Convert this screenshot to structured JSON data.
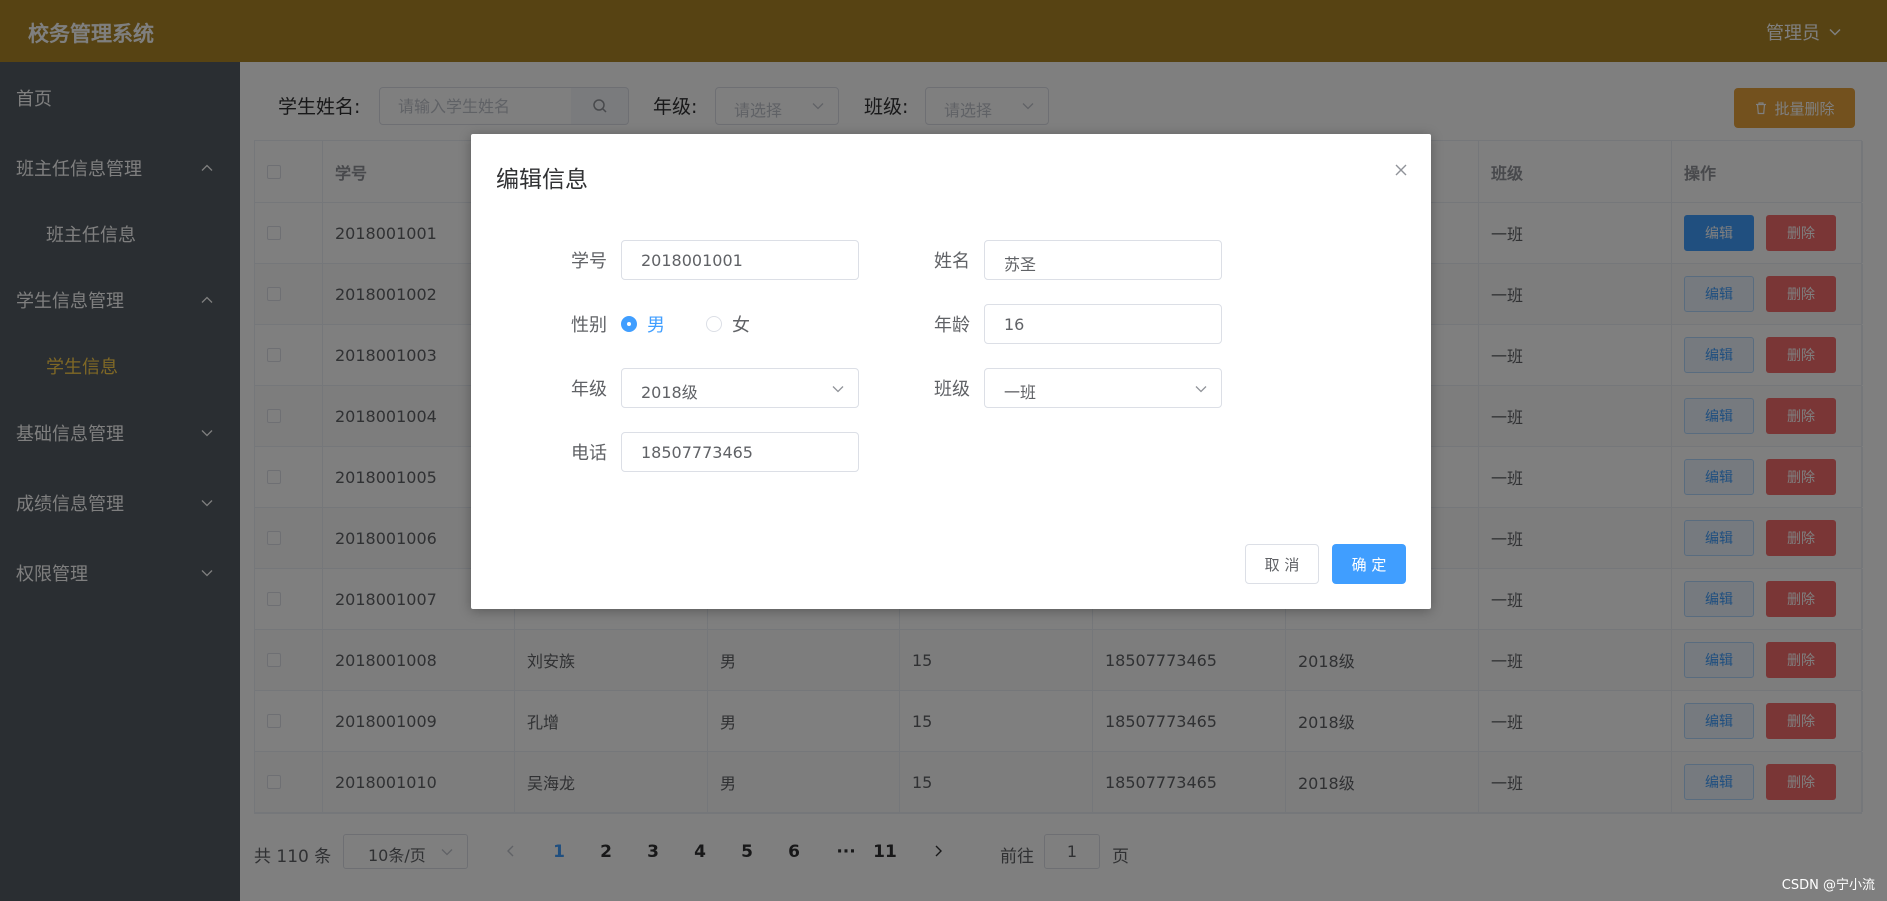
{
  "header": {
    "title": "校务管理系统",
    "user": "管理员"
  },
  "sidebar": {
    "items": [
      {
        "label": "首页"
      },
      {
        "label": "班主任信息管理"
      },
      {
        "label": "班主任信息"
      },
      {
        "label": "学生信息管理"
      },
      {
        "label": "学生信息"
      },
      {
        "label": "基础信息管理"
      },
      {
        "label": "成绩信息管理"
      },
      {
        "label": "权限管理"
      }
    ]
  },
  "filter": {
    "name_label": "学生姓名:",
    "name_placeholder": "请输入学生姓名",
    "grade_label": "年级:",
    "grade_placeholder": "请选择",
    "class_label": "班级:",
    "class_placeholder": "请选择",
    "batch_delete": "批量删除"
  },
  "table": {
    "headers": [
      "学号",
      "班级",
      "操作"
    ],
    "rows": [
      {
        "id": "2018001001",
        "class": "一班"
      },
      {
        "id": "2018001002",
        "class": "一班"
      },
      {
        "id": "2018001003",
        "class": "一班"
      },
      {
        "id": "2018001004",
        "class": "一班"
      },
      {
        "id": "2018001005",
        "class": "一班"
      },
      {
        "id": "2018001006",
        "class": "一班"
      },
      {
        "id": "2018001007",
        "class": "一班"
      },
      {
        "id": "2018001008",
        "name": "刘安族",
        "gender": "男",
        "age": "15",
        "phone": "18507773465",
        "grade": "2018级",
        "class": "一班"
      },
      {
        "id": "2018001009",
        "name": "孔增",
        "gender": "男",
        "age": "15",
        "phone": "18507773465",
        "grade": "2018级",
        "class": "一班"
      },
      {
        "id": "2018001010",
        "name": "吴海龙",
        "gender": "男",
        "age": "15",
        "phone": "18507773465",
        "grade": "2018级",
        "class": "一班"
      }
    ],
    "edit_label": "编辑",
    "delete_label": "删除"
  },
  "pagination": {
    "total": "共 110 条",
    "page_size": "10条/页",
    "pages": [
      "1",
      "2",
      "3",
      "4",
      "5",
      "6",
      "···",
      "11"
    ],
    "current": "1",
    "goto_label": "前往",
    "goto_value": "1",
    "page_label": "页"
  },
  "dialog": {
    "title": "编辑信息",
    "id_label": "学号",
    "id_value": "2018001001",
    "name_label": "姓名",
    "name_value": "苏圣",
    "gender_label": "性别",
    "gender_male": "男",
    "gender_female": "女",
    "age_label": "年龄",
    "age_value": "16",
    "grade_label": "年级",
    "grade_value": "2018级",
    "class_label": "班级",
    "class_value": "一班",
    "phone_label": "电话",
    "phone_value": "18507773465",
    "cancel": "取 消",
    "confirm": "确 定"
  },
  "watermark": "CSDN @宁小流",
  "colors": {
    "header": "#AE8726",
    "sidebar": "#545c64",
    "primary": "#409eff",
    "danger": "#f56c6c",
    "warning": "#e6a23c",
    "active_menu": "#ffd04b"
  }
}
